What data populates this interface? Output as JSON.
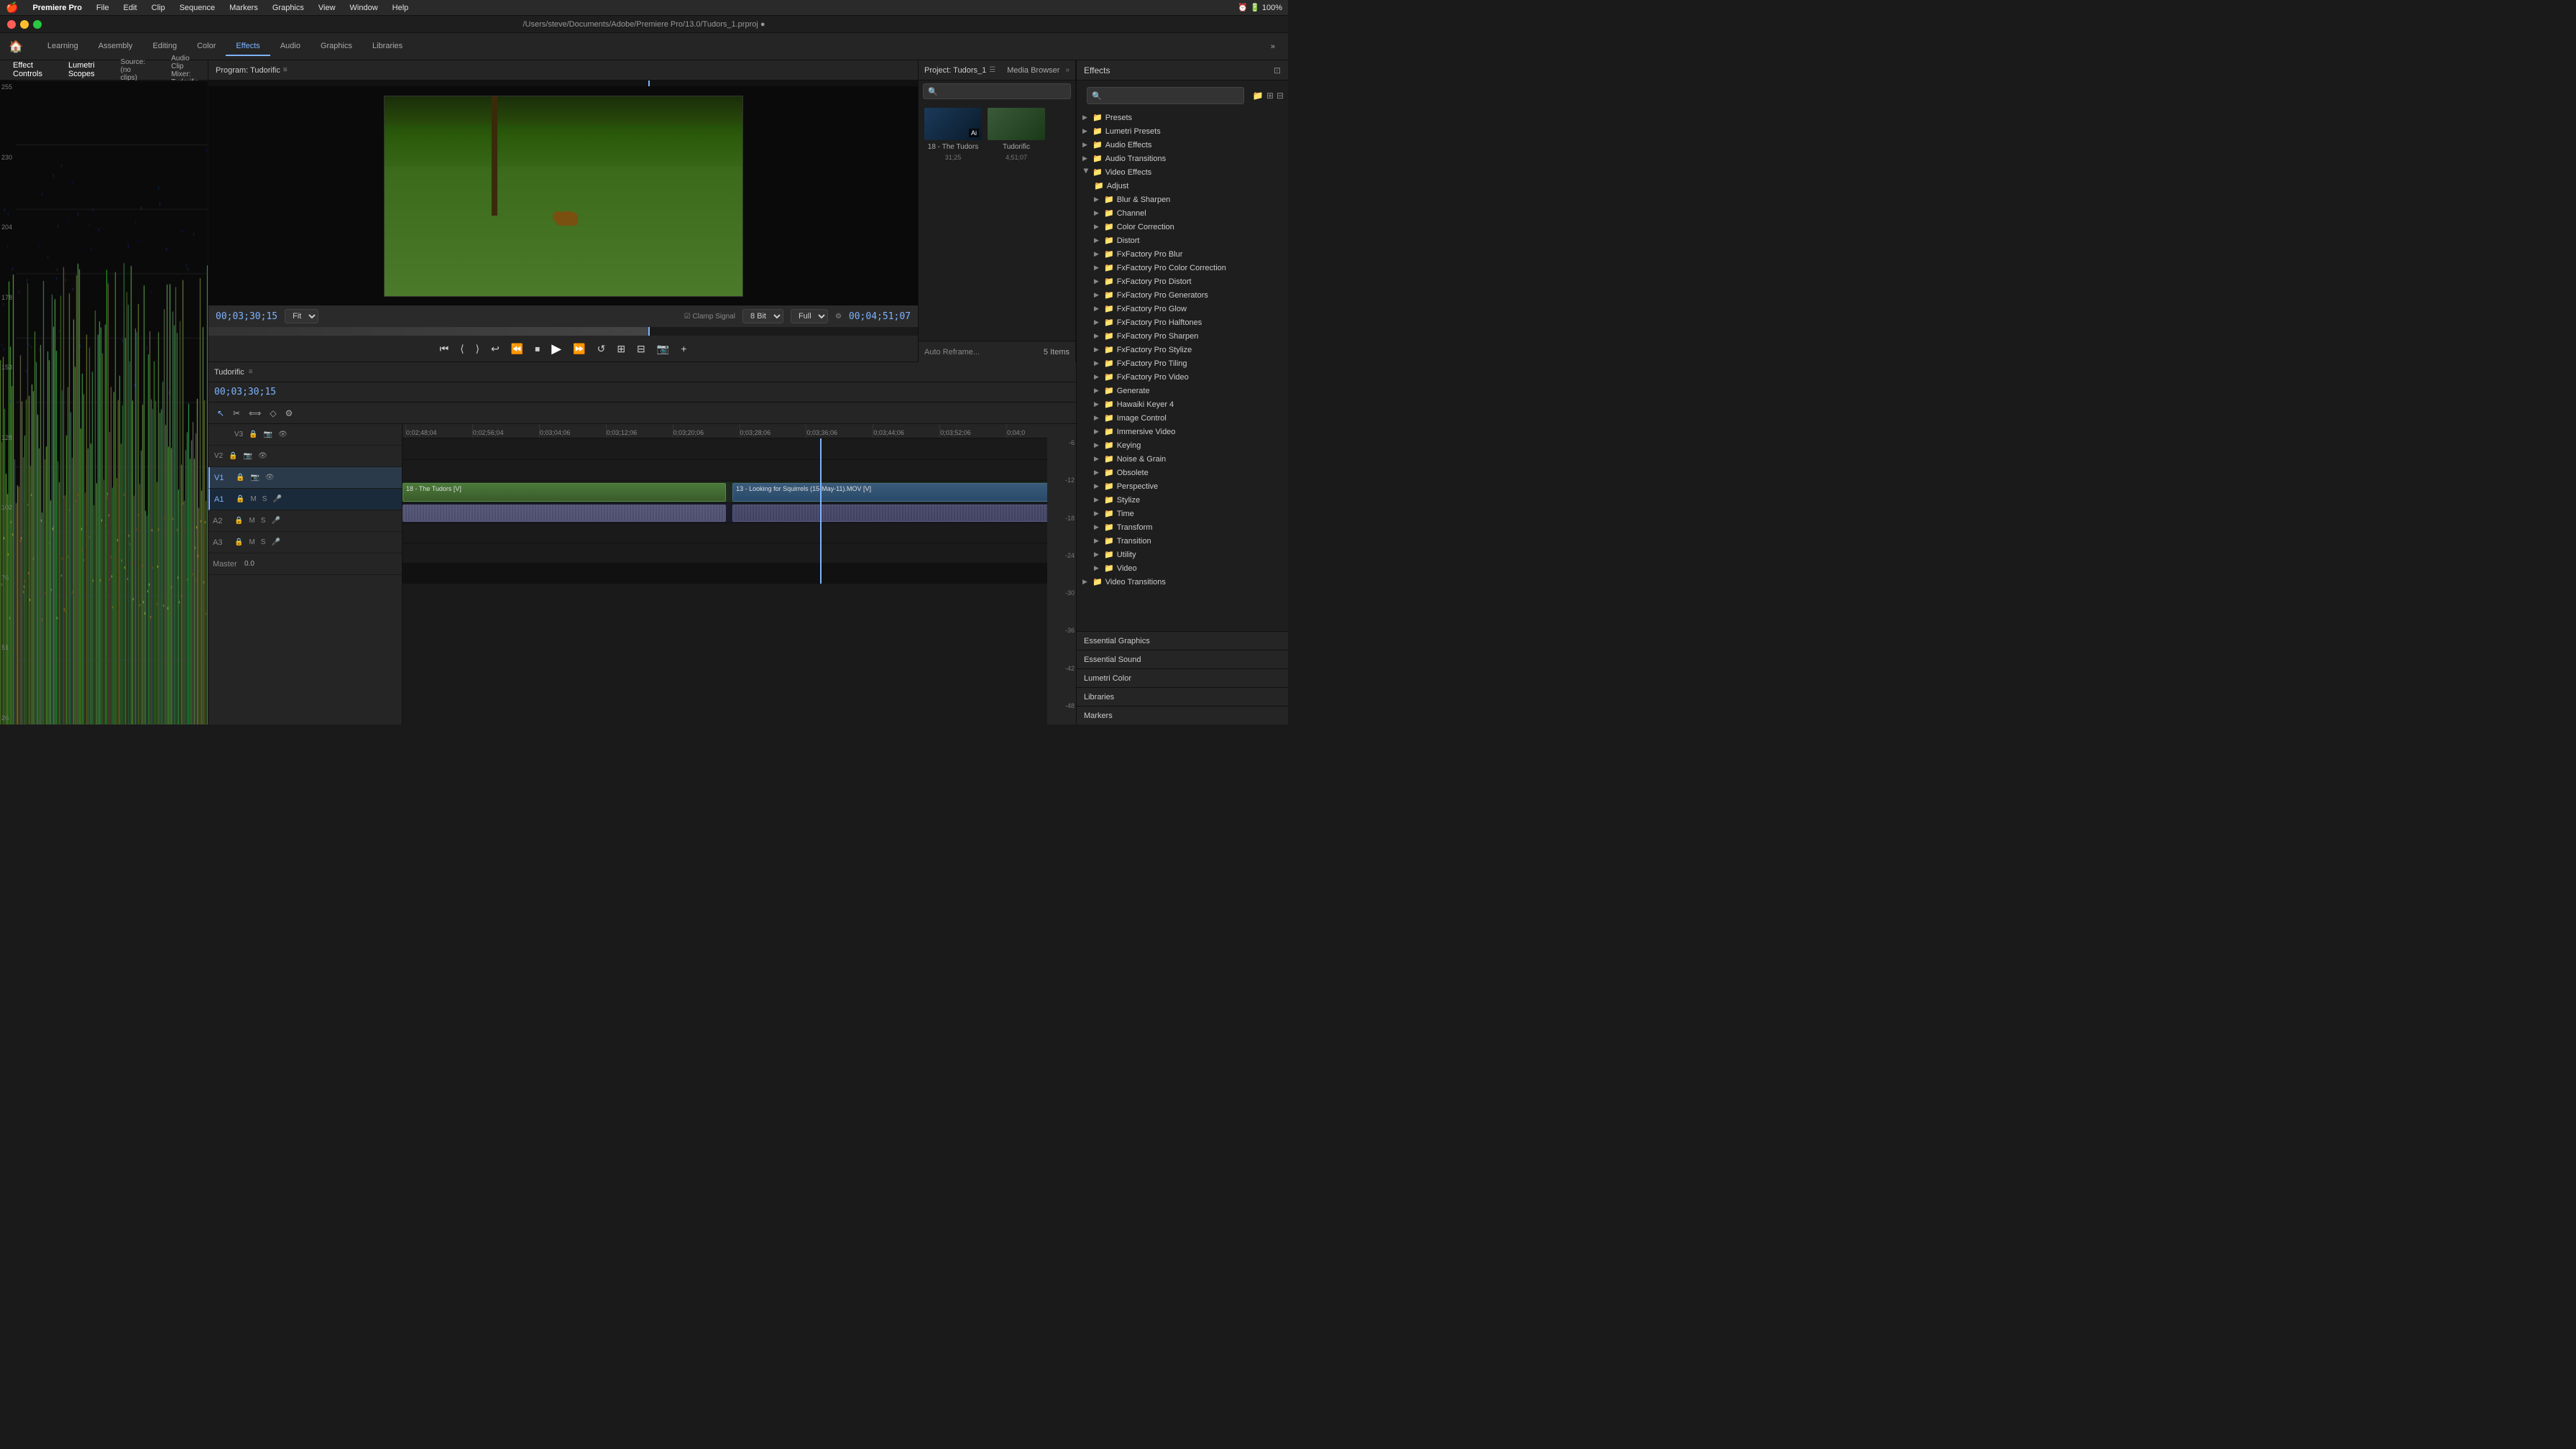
{
  "window": {
    "title": "/Users/steve/Documents/Adobe/Premiere Pro/13.0/Tudors_1.prproj ●"
  },
  "mac_menubar": {
    "apple": "🍎",
    "items": [
      "Premiere Pro",
      "File",
      "Edit",
      "Clip",
      "Sequence",
      "Markers",
      "Graphics",
      "View",
      "Window",
      "Help"
    ],
    "right": "100% 🔋"
  },
  "main_toolbar": {
    "home_icon": "🏠",
    "workspace_tabs": [
      "Learning",
      "Assembly",
      "Editing",
      "Color",
      "Effects",
      "Audio",
      "Graphics",
      "Libraries"
    ],
    "active_tab": "Effects",
    "overflow": "»"
  },
  "left_panel": {
    "tabs": [
      "Effect Controls",
      "Lumetri Scopes",
      "Source: (no clips)",
      "Audio Clip Mixer: Tudorific"
    ],
    "active_tab": "Lumetri Scopes",
    "y_axis_labels": [
      "255",
      "230",
      "204",
      "178",
      "153",
      "128",
      "102",
      "76",
      "51",
      "26"
    ]
  },
  "program_monitor": {
    "title": "Program: Tudorific",
    "timecode_in": "00;03;30;15",
    "fit_label": "Fit",
    "quality_label": "Full",
    "timecode_out": "00;04;51;07",
    "clamp_signal_label": "Clamp Signal",
    "bit_depth_label": "8 Bit"
  },
  "project_panel": {
    "title": "Project: Tudors_1",
    "tab_label": "Media Browser",
    "search_placeholder": "",
    "items": [
      {
        "name": "18 - The Tudors",
        "duration": "31;25",
        "thumb_class": "thumb-1"
      },
      {
        "name": "Tudorific",
        "duration": "4;51;07",
        "thumb_class": "thumb-2"
      }
    ],
    "footer_text": "Auto Reframe...",
    "item_count": "5 Items",
    "ai_label": "Ai"
  },
  "timeline": {
    "title": "Tudorific",
    "timecode": "00;03;30;15",
    "ruler_times": [
      "0;02;48;04",
      "0;02;56;04",
      "0;03;04;06",
      "0;03;12;06",
      "0;03;20;06",
      "0;03;28;06",
      "0;03;36;06",
      "0;03;44;06",
      "0;03;52;06",
      "0;04;0"
    ],
    "tracks": [
      {
        "id": "V3",
        "label": "V3",
        "type": "video"
      },
      {
        "id": "V2",
        "label": "V2",
        "type": "video"
      },
      {
        "id": "V1",
        "label": "V1",
        "type": "video"
      },
      {
        "id": "A1",
        "label": "A1",
        "type": "audio"
      },
      {
        "id": "A2",
        "label": "A2",
        "type": "audio"
      },
      {
        "id": "A3",
        "label": "A3",
        "type": "audio"
      },
      {
        "id": "Master",
        "label": "Master",
        "type": "master"
      }
    ],
    "clips": [
      {
        "track": "V1",
        "label": "18 - The Tudors [V]",
        "start": "0%",
        "width": "48%"
      },
      {
        "track": "V1",
        "label": "13 - Looking for Squirrels (15-May-11).MOV [V]",
        "start": "49%",
        "width": "50%"
      }
    ],
    "level_labels": [
      "-6",
      "-12",
      "-18",
      "-24",
      "-30",
      "-36",
      "-42",
      "-48"
    ]
  },
  "effects_panel": {
    "title": "Effects",
    "search_placeholder": "",
    "tree": [
      {
        "label": "Presets",
        "icon": "📁",
        "expanded": false,
        "children": []
      },
      {
        "label": "Lumetri Presets",
        "icon": "📁",
        "expanded": false,
        "children": []
      },
      {
        "label": "Audio Effects",
        "icon": "📁",
        "expanded": false,
        "children": []
      },
      {
        "label": "Audio Transitions",
        "icon": "📁",
        "expanded": false,
        "children": []
      },
      {
        "label": "Video Effects",
        "icon": "📁",
        "expanded": true,
        "children": [
          {
            "label": "Adjust",
            "icon": "📁"
          },
          {
            "label": "Blur & Sharpen",
            "icon": "📁"
          },
          {
            "label": "Channel",
            "icon": "📁"
          },
          {
            "label": "Color Correction",
            "icon": "📁"
          },
          {
            "label": "Distort",
            "icon": "📁"
          },
          {
            "label": "FxFactory Pro Blur",
            "icon": "📁"
          },
          {
            "label": "FxFactory Pro Color Correction",
            "icon": "📁"
          },
          {
            "label": "FxFactory Pro Distort",
            "icon": "📁"
          },
          {
            "label": "FxFactory Pro Generators",
            "icon": "📁"
          },
          {
            "label": "FxFactory Pro Glow",
            "icon": "📁"
          },
          {
            "label": "FxFactory Pro Halftones",
            "icon": "📁"
          },
          {
            "label": "FxFactory Pro Sharpen",
            "icon": "📁"
          },
          {
            "label": "FxFactory Pro Stylize",
            "icon": "📁"
          },
          {
            "label": "FxFactory Pro Tiling",
            "icon": "📁"
          },
          {
            "label": "FxFactory Pro Video",
            "icon": "📁"
          },
          {
            "label": "Generate",
            "icon": "📁"
          },
          {
            "label": "Hawaiki Keyer 4",
            "icon": "📁"
          },
          {
            "label": "Image Control",
            "icon": "📁"
          },
          {
            "label": "Immersive Video",
            "icon": "📁"
          },
          {
            "label": "Keying",
            "icon": "📁"
          },
          {
            "label": "Noise & Grain",
            "icon": "📁"
          },
          {
            "label": "Obsolete",
            "icon": "📁"
          },
          {
            "label": "Perspective",
            "icon": "📁"
          },
          {
            "label": "Stylize",
            "icon": "📁"
          },
          {
            "label": "Time",
            "icon": "📁"
          },
          {
            "label": "Transform",
            "icon": "📁"
          },
          {
            "label": "Transition",
            "icon": "📁"
          },
          {
            "label": "Utility",
            "icon": "📁"
          },
          {
            "label": "Video",
            "icon": "📁"
          }
        ]
      },
      {
        "label": "Video Transitions",
        "icon": "📁",
        "expanded": false,
        "children": []
      }
    ],
    "bottom_sections": [
      {
        "label": "Essential Graphics"
      },
      {
        "label": "Essential Sound"
      },
      {
        "label": "Lumetri Color"
      },
      {
        "label": "Libraries"
      },
      {
        "label": "Markers"
      }
    ]
  }
}
